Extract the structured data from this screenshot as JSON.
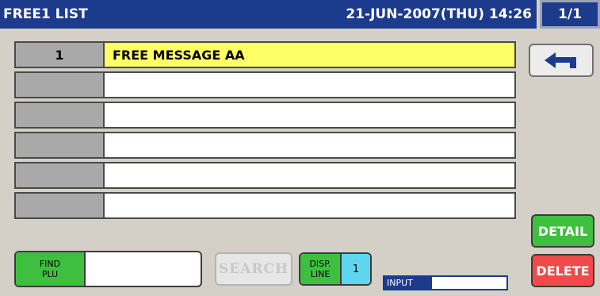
{
  "header": {
    "title": "FREE1 LIST",
    "datetime": "21-JUN-2007(THU) 14:26",
    "page": "1/1"
  },
  "list": {
    "rows": [
      {
        "num": "1",
        "message": "FREE MESSAGE AA",
        "selected": true
      },
      {
        "num": "",
        "message": "",
        "selected": false
      },
      {
        "num": "",
        "message": "",
        "selected": false
      },
      {
        "num": "",
        "message": "",
        "selected": false
      },
      {
        "num": "",
        "message": "",
        "selected": false
      },
      {
        "num": "",
        "message": "",
        "selected": false
      }
    ]
  },
  "buttons": {
    "back_icon": "return-arrow-icon",
    "detail": "DETAIL",
    "delete": "DELETE",
    "search": "SEARCH"
  },
  "find_plu": {
    "label_line1": "FIND",
    "label_line2": "PLU",
    "value": ""
  },
  "disp_line": {
    "label_line1": "DISP.",
    "label_line2": "LINE",
    "value": "1"
  },
  "input_indicator": {
    "label": "INPUT"
  },
  "colors": {
    "header_bg": "#1c3b8c",
    "selected_row": "#ffff66",
    "green_button": "#3fbf3f",
    "red_button": "#f24a4a",
    "cyan_value": "#5fd6f0"
  }
}
